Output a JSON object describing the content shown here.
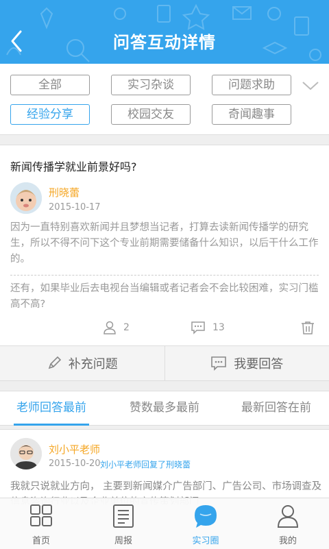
{
  "header": {
    "title": "问答互动详情"
  },
  "categories": [
    {
      "label": "全部"
    },
    {
      "label": "实习杂谈"
    },
    {
      "label": "问题求助"
    },
    {
      "label": "经验分享"
    },
    {
      "label": "校园交友"
    },
    {
      "label": "奇闻趣事"
    }
  ],
  "active_category": "经验分享",
  "question": {
    "title": "新闻传播学就业前景好吗?",
    "author": "刑晓蕾",
    "date": "2015-10-17",
    "body": "因为一直特别喜欢新闻并且梦想当记者，打算去读新闻传播学的研究生，所以不得不问下这个专业前期需要储备什么知识，以后干什么工作的。",
    "extra": "还有，如果毕业后去电视台当编辑或者记者会不会比较困难，实习门槛高不高?",
    "follow_count": "2",
    "comment_count": "13"
  },
  "actions": {
    "supplement": "补充问题",
    "answer": "我要回答"
  },
  "sort_tabs": [
    {
      "label": "老师回答最前"
    },
    {
      "label": "赞数最多最前"
    },
    {
      "label": "最新回答在前"
    }
  ],
  "answer": {
    "author": "刘小平老师",
    "date": "2015-10-20",
    "note": "刘小平老师回复了刑晓蕾",
    "body": "我就只说就业方向， 主要到新闻媒介广告部门、广告公司、市场调查及信息咨询行业以及企业单位的宣传策划部门"
  },
  "bottom_nav": [
    {
      "label": "首页"
    },
    {
      "label": "周报"
    },
    {
      "label": "实习圈"
    },
    {
      "label": "我的"
    }
  ],
  "colors": {
    "accent": "#35a4ec",
    "author": "#f5a623",
    "muted": "#999999"
  }
}
